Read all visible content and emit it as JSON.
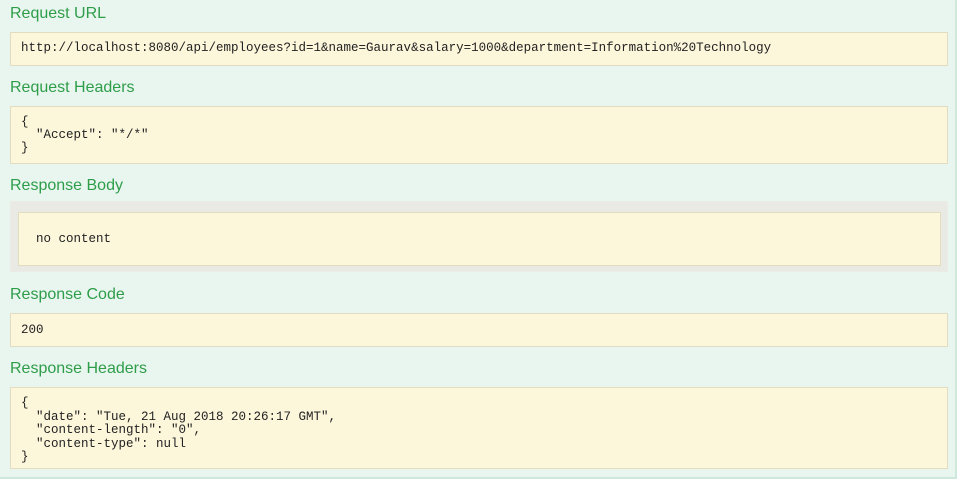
{
  "request_url": {
    "heading": "Request URL",
    "value": "http://localhost:8080/api/employees?id=1&name=Gaurav&salary=1000&department=Information%20Technology"
  },
  "request_headers": {
    "heading": "Request Headers",
    "value": "{\n  \"Accept\": \"*/*\"\n}"
  },
  "response_body": {
    "heading": "Response Body",
    "value": "no content"
  },
  "response_code": {
    "heading": "Response Code",
    "value": "200"
  },
  "response_headers": {
    "heading": "Response Headers",
    "value": "{\n  \"date\": \"Tue, 21 Aug 2018 20:26:17 GMT\",\n  \"content-length\": \"0\",\n  \"content-type\": null\n}"
  }
}
